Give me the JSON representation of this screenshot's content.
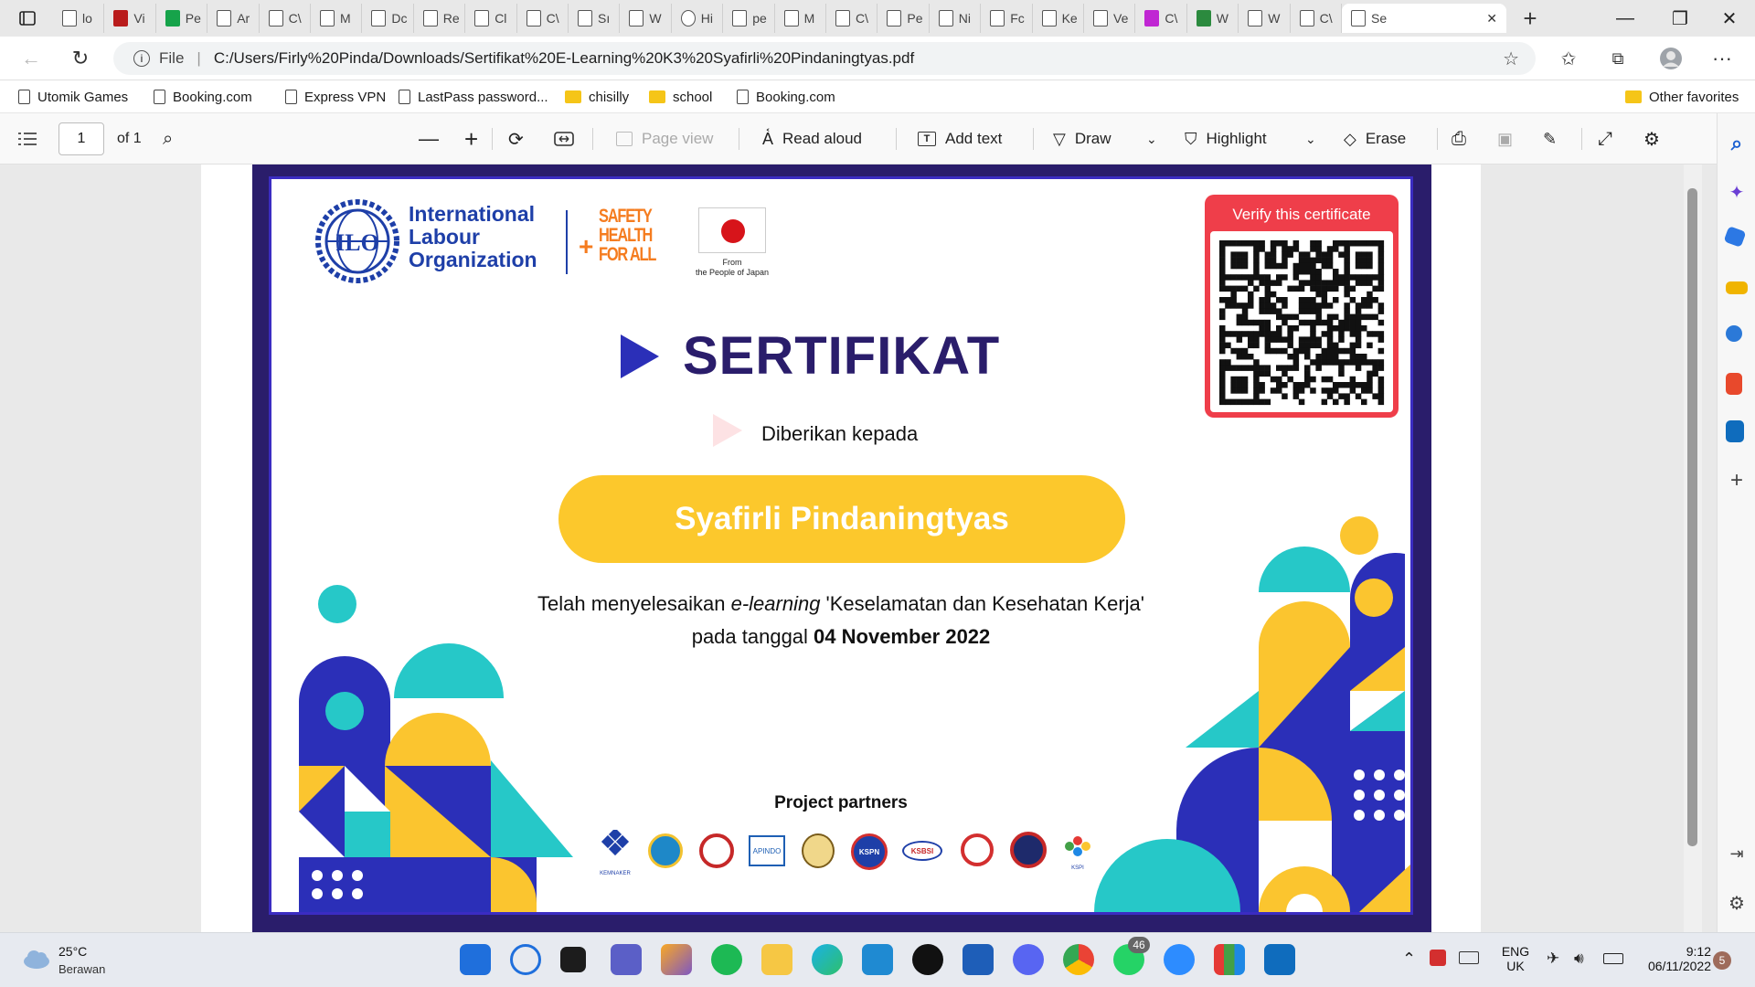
{
  "browser": {
    "tabs": [
      {
        "label": "lo"
      },
      {
        "label": "Vi"
      },
      {
        "label": "Pe"
      },
      {
        "label": "Ar"
      },
      {
        "label": "C\\"
      },
      {
        "label": "M"
      },
      {
        "label": "Dc"
      },
      {
        "label": "Re"
      },
      {
        "label": "Cl"
      },
      {
        "label": "C\\"
      },
      {
        "label": "Sı"
      },
      {
        "label": "W"
      },
      {
        "label": "Hi"
      },
      {
        "label": "pe"
      },
      {
        "label": "M"
      },
      {
        "label": "C\\"
      },
      {
        "label": "Pe"
      },
      {
        "label": "Ni"
      },
      {
        "label": "Fc"
      },
      {
        "label": "Ke"
      },
      {
        "label": "Ve"
      },
      {
        "label": "C\\"
      },
      {
        "label": "W"
      },
      {
        "label": "W"
      },
      {
        "label": "C\\"
      },
      {
        "label": "Se"
      }
    ],
    "file_label": "File",
    "url": "C:/Users/Firly%20Pinda/Downloads/Sertifikat%20E-Learning%20K3%20Syafirli%20Pindaningtyas.pdf",
    "favorites": [
      "Utomik Games",
      "Booking.com",
      "Express VPN",
      "LastPass password...",
      "chisilly",
      "school",
      "Booking.com"
    ],
    "other_favorites": "Other favorites"
  },
  "pdf_toolbar": {
    "page_value": "1",
    "page_total": "of 1",
    "page_view": "Page view",
    "read_aloud": "Read aloud",
    "add_text": "Add text",
    "draw": "Draw",
    "highlight": "Highlight",
    "erase": "Erase"
  },
  "certificate": {
    "org_line1": "International",
    "org_line2": "Labour",
    "org_line3": "Organization",
    "ilo_mark": "ILO",
    "safety_line1": "SAFETY",
    "safety_line2": "HEALTH",
    "safety_line3": "FOR ALL",
    "japan_line1": "From",
    "japan_line2": "the People of Japan",
    "verify_label": "Verify this certificate",
    "title": "SERTIFIKAT",
    "given_to": "Diberikan kepada",
    "recipient": "Syafirli Pindaningtyas",
    "completed_prefix": "Telah menyelesaikan ",
    "completed_em": "e-learning",
    "completed_suffix": " 'Keselamatan dan Kesehatan Kerja'",
    "date_prefix": "pada tanggal ",
    "date_value": "04 November 2022",
    "partners_title": "Project partners",
    "partner_labels": [
      "KEMNAKER",
      "APINDO",
      "KSPN",
      "KSBSI",
      "KSPI"
    ]
  },
  "taskbar": {
    "temperature": "25°C",
    "weather": "Berawan",
    "whatsapp_badge": "46",
    "lang_line1": "ENG",
    "lang_line2": "UK",
    "time": "9:12",
    "date": "06/11/2022",
    "notif_badge": "5"
  },
  "colors": {
    "cert_navy": "#2a1d6b",
    "cert_blue": "#2b2fb8",
    "cert_yellow": "#fbc52f",
    "cert_teal": "#26c8c8",
    "ilo_blue": "#1e3fa8",
    "safety_orange": "#f57c1f",
    "verify_red": "#ef3e4a"
  }
}
